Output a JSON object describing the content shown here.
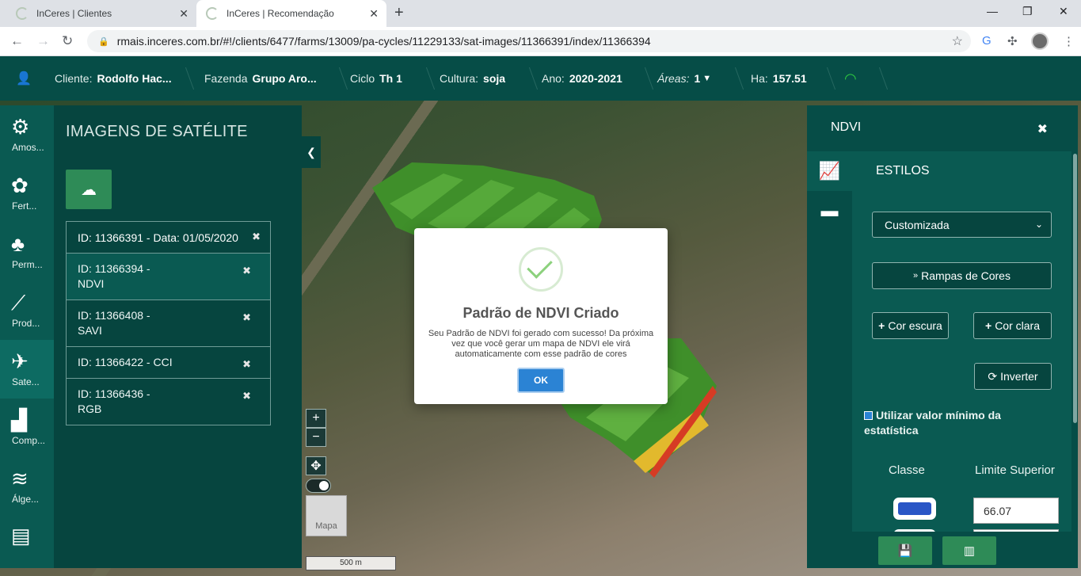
{
  "browser": {
    "tabs": [
      {
        "title": "InCeres | Clientes",
        "active": false
      },
      {
        "title": "InCeres | Recomendação",
        "active": true
      }
    ],
    "url": "rmais.inceres.com.br/#!/clients/6477/farms/13009/pa-cycles/11229133/sat-images/11366391/index/11366394"
  },
  "header": {
    "cliente_label": "Cliente:",
    "cliente_value": "Rodolfo Hac...",
    "fazenda_label": "Fazenda",
    "fazenda_value": "Grupo Aro...",
    "ciclo_label": "Ciclo",
    "ciclo_value": "Th 1",
    "cultura_label": "Cultura:",
    "cultura_value": "soja",
    "ano_label": "Ano:",
    "ano_value": "2020-2021",
    "areas_label": "Áreas:",
    "areas_value": "1",
    "ha_label": "Ha:",
    "ha_value": "157.51"
  },
  "sidebar": {
    "items": [
      {
        "label": "Amos...",
        "icon": "sampling-icon",
        "active": false
      },
      {
        "label": "Fert...",
        "icon": "fertility-icon",
        "active": false
      },
      {
        "label": "Perm...",
        "icon": "plants-icon",
        "active": false
      },
      {
        "label": "Prod...",
        "icon": "productivity-chart-icon",
        "active": false
      },
      {
        "label": "Sate...",
        "icon": "satellite-icon",
        "active": true
      },
      {
        "label": "Comp...",
        "icon": "compaction-icon",
        "active": false
      },
      {
        "label": "Álge...",
        "icon": "layers-icon",
        "active": false
      },
      {
        "label": "",
        "icon": "report-icon",
        "active": false
      }
    ]
  },
  "satellite": {
    "title": "IMAGENS DE SATÉLITE",
    "header_item": "ID: 11366391 - Data: 01/05/2020",
    "images": [
      {
        "line1": "ID: 11366394 -",
        "line2": "NDVI",
        "selected": true
      },
      {
        "line1": "ID: 11366408 -",
        "line2": "SAVI",
        "selected": false
      },
      {
        "line1": "ID: 11366422 - CCI",
        "line2": "",
        "selected": false
      },
      {
        "line1": "ID: 11366436 -",
        "line2": "RGB",
        "selected": false
      }
    ]
  },
  "map": {
    "thumb_label": "Mapa",
    "scale_label": "500 m"
  },
  "modal": {
    "title": "Padrão de NDVI Criado",
    "text": "Seu Padrão de NDVI foi gerado com sucesso! Da próxima vez que você gerar um mapa de NDVI ele virá automaticamente com esse padrão de cores",
    "ok_label": "OK"
  },
  "ndvi": {
    "title": "NDVI",
    "section": "ESTILOS",
    "select_value": "Customizada",
    "ramps_label": "Rampas de Cores",
    "dark_label": "Cor escura",
    "light_label": "Cor clara",
    "invert_label": "Inverter",
    "checkbox_label": "Utilizar valor mínimo da estatística",
    "col_class": "Classe",
    "col_limit": "Limite Superior",
    "rows": [
      {
        "color": "#2a56c6",
        "limit": "66.07"
      }
    ]
  },
  "colors": {
    "header_bg": "#064d47",
    "panel_bg": "#06453f",
    "accent_green": "#2e8b57",
    "ok_blue": "#2b83d4"
  }
}
